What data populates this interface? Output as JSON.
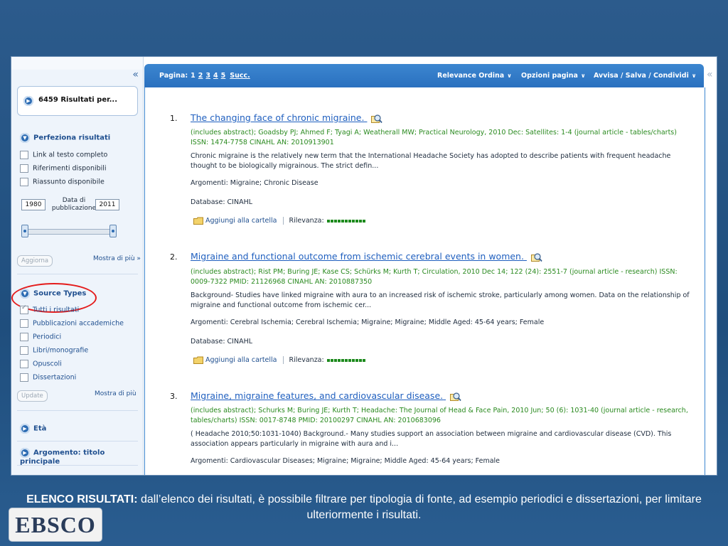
{
  "sidebar": {
    "collapse_glyph": "«",
    "results_summary": "6459 Risultati per...",
    "refine_title": "Perfeziona risultati",
    "refine_options": [
      "Link al testo completo",
      "Riferimenti disponibili",
      "Riassunto disponibile"
    ],
    "year_from": "1980",
    "year_to": "2011",
    "date_label_line1": "Data di",
    "date_label_line2": "pubblicazione",
    "update_button_1": "Aggiorna",
    "show_more_1": "Mostra di più »",
    "source_types_title": "Source Types",
    "source_types": [
      "Tutti i risultati",
      "Pubblicazioni accademiche",
      "Periodici",
      "Libri/monografie",
      "Opuscoli",
      "Dissertazioni"
    ],
    "update_button_2": "Update",
    "show_more_2": "Mostra di più",
    "age_title": "Età",
    "subject_title": "Argomento: titolo principale"
  },
  "toolbar": {
    "pages_label": "Pagina:",
    "current_page": "1",
    "pages": [
      "2",
      "3",
      "4",
      "5"
    ],
    "next_label": "Succ.",
    "relevance_sort": "Relevance Ordina",
    "page_options": "Opzioni pagina",
    "alert_save_share": "Avvisa / Salva / Condividi",
    "collapse_right_glyph": "«"
  },
  "results": [
    {
      "num": "1.",
      "title": "The changing face of chronic migraine.",
      "meta": "(includes abstract); Goadsby PJ; Ahmed F; Tyagi A; Weatherall MW; Practical Neurology, 2010 Dec: Satellites: 1-4 (journal article - tables/charts) ISSN: 1474-7758 CINAHL AN: 2010913901",
      "abstract": "Chronic migraine is the relatively new term that the International Headache Society has adopted to describe patients with frequent headache thought to be biologically migrainous. The strict defin...",
      "subjects": "Argomenti: Migraine; Chronic Disease",
      "database": "Database: CINAHL",
      "add_folder": "Aggiungi alla cartella",
      "relevance_label": "Rilevanza:"
    },
    {
      "num": "2.",
      "title": "Migraine and functional outcome from ischemic cerebral events in women.",
      "meta": "(includes abstract); Rist PM; Buring JE; Kase CS; Schürks M; Kurth T; Circulation, 2010 Dec 14; 122 (24): 2551-7 (journal article - research) ISSN: 0009-7322 PMID: 21126968 CINAHL AN: 2010887350",
      "abstract": "Background- Studies have linked migraine with aura to an increased risk of ischemic stroke, particularly among women. Data on the relationship of migraine and functional outcome from ischemic cer...",
      "subjects": "Argomenti: Cerebral Ischemia; Cerebral Ischemia; Migraine; Migraine; Middle Aged: 45-64 years; Female",
      "database": "Database: CINAHL",
      "add_folder": "Aggiungi alla cartella",
      "relevance_label": "Rilevanza:"
    },
    {
      "num": "3.",
      "title": "Migraine, migraine features, and cardiovascular disease.",
      "meta": "(includes abstract); Schurks M; Buring JE; Kurth T; Headache: The Journal of Head & Face Pain, 2010 Jun; 50 (6): 1031-40 (journal article - research, tables/charts) ISSN: 0017-8748 PMID: 20100297 CINAHL AN: 2010683096",
      "abstract": "( Headache 2010;50:1031-1040) Background.- Many studies support an association between migraine and cardiovascular disease (CVD). This association appears particularly in migraine with aura and i...",
      "subjects": "Argomenti: Cardiovascular Diseases; Migraine; Migraine; Middle Aged: 45-64 years; Female"
    }
  ],
  "caption": {
    "bold": "ELENCO RISULTATI:",
    "text": " dall’elenco dei risultati, è possibile filtrare per tipologia di fonte, ad esempio periodici e dissertazioni, per limitare ulteriormente i risultati."
  },
  "logo_text": "EBSCO",
  "colors": {
    "accent": "#2a70bf",
    "link": "#1f5fbf",
    "meta_green": "#2a8a1f",
    "highlight_red": "#e41c1c"
  }
}
